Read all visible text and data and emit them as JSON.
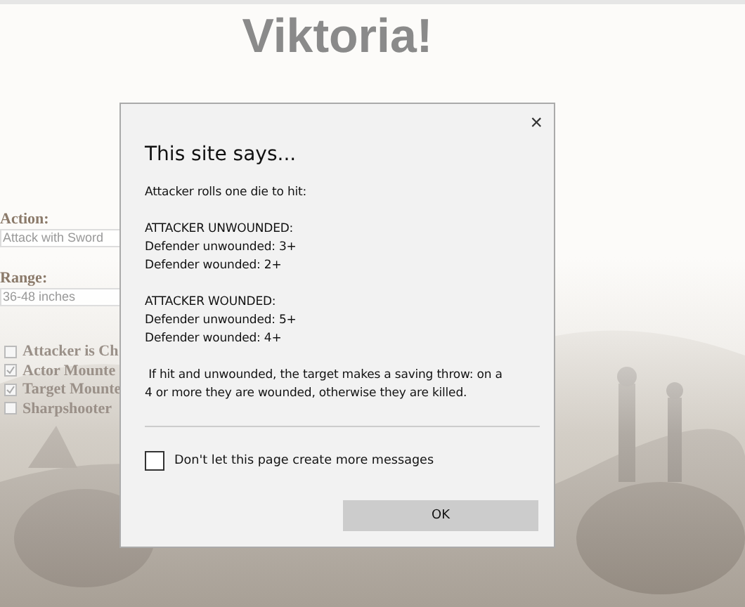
{
  "page": {
    "title": "Viktoria!",
    "form": {
      "action": {
        "label": "Action:",
        "value": "Attack with Sword"
      },
      "range": {
        "label": "Range:",
        "value": "36-48 inches"
      },
      "options": [
        {
          "label": "Attacker is Ch",
          "checked": false
        },
        {
          "label": "Actor Mounte",
          "checked": true
        },
        {
          "label": "Target Mounte",
          "checked": true
        },
        {
          "label": "Sharpshooter",
          "checked": false
        }
      ]
    }
  },
  "dialog": {
    "close": "×",
    "title": "This site says...",
    "paragraphs": [
      [
        "Attacker rolls one die to hit:"
      ],
      [
        "ATTACKER UNWOUNDED:",
        "Defender unwounded: 3+",
        "Defender wounded: 2+"
      ],
      [
        "ATTACKER WOUNDED:",
        "Defender unwounded: 5+",
        "Defender wounded: 4+"
      ],
      [
        " If hit and unwounded, the target makes a saving throw: on a 4 or more they are wounded, otherwise they are killed."
      ]
    ],
    "suppress": {
      "label": "Don't let this page create more messages",
      "checked": false
    },
    "ok": "OK"
  }
}
